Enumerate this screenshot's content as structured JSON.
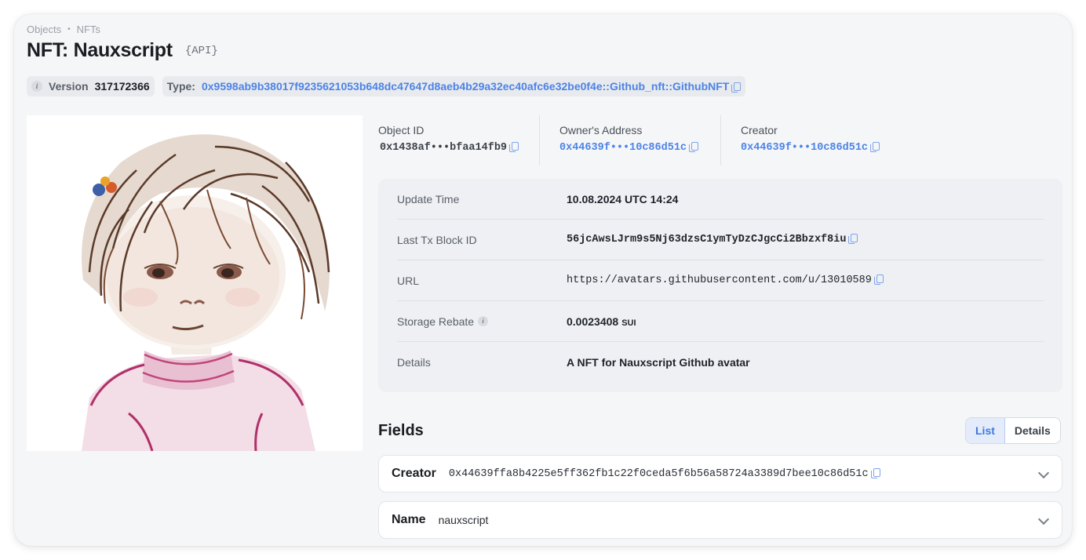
{
  "breadcrumb": {
    "items": [
      "Objects",
      "NFTs"
    ],
    "separator": "•"
  },
  "title": "NFT: Nauxscript",
  "api_tag": "{API}",
  "version": {
    "label": "Version",
    "value": "317172366",
    "icon": "info-icon"
  },
  "type": {
    "label": "Type:",
    "value": "0x9598ab9b38017f9235621053b648dc47647d8aeb4b29a32ec40afc6e32be0f4e::Github_nft::GithubNFT"
  },
  "ids": {
    "object_id": {
      "label": "Object ID",
      "value": "0x1438af•••bfaa14fb9"
    },
    "owner": {
      "label": "Owner's Address",
      "value": "0x44639f•••10c86d51c"
    },
    "creator": {
      "label": "Creator",
      "value": "0x44639f•••10c86d51c"
    }
  },
  "details": {
    "update_time": {
      "label": "Update Time",
      "value": "10.08.2024 UTC 14:24"
    },
    "last_tx": {
      "label": "Last Tx Block ID",
      "value": "56jcAwsLJrm9s5Nj63dzsC1ymTyDzCJgcCi2Bbzxf8iu"
    },
    "url": {
      "label": "URL",
      "value": "https://avatars.githubusercontent.com/u/13010589"
    },
    "storage_rebate": {
      "label": "Storage Rebate",
      "value": "0.0023408",
      "unit": "SUI"
    },
    "details": {
      "label": "Details",
      "value": "A NFT for Nauxscript Github avatar"
    }
  },
  "fields": {
    "title": "Fields",
    "view_options": [
      "List",
      "Details"
    ],
    "selected_view": "List",
    "items": [
      {
        "name": "Creator",
        "value": "0x44639ffa8b4225e5ff362fb1c22f0ceda5f6b56a58724a3389d7bee10c86d51c"
      },
      {
        "name": "Name",
        "value": "nauxscript"
      }
    ]
  },
  "colors": {
    "link": "#4c83e6",
    "card_bg": "#f5f6f8",
    "detail_bg": "#eef0f4"
  }
}
